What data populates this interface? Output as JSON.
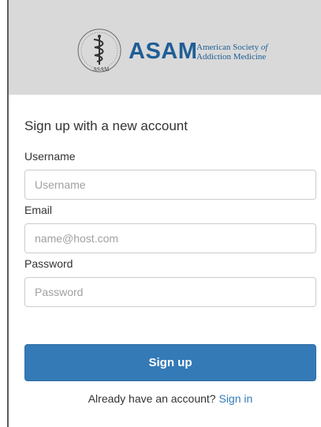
{
  "header": {
    "logo": {
      "seal_text": "ASAM",
      "wordmark": "ASAM",
      "subtitle_line1_prefix": "American Society ",
      "subtitle_line1_italic": "of",
      "subtitle_line2": "Addiction Medicine",
      "brand_color": "#1f5e96"
    }
  },
  "form": {
    "title": "Sign up with a new account",
    "username": {
      "label": "Username",
      "value": "",
      "placeholder": "Username"
    },
    "email": {
      "label": "Email",
      "value": "",
      "placeholder": "name@host.com"
    },
    "password": {
      "label": "Password",
      "value": "",
      "placeholder": "Password"
    },
    "submit_label": "Sign up",
    "footer_prompt": "Already have an account? ",
    "signin_link": "Sign in"
  },
  "colors": {
    "header_bg": "#d9d9d9",
    "primary": "#337ab7",
    "link": "#337ab7"
  }
}
